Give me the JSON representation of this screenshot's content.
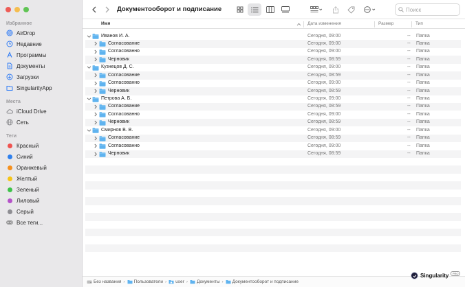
{
  "window": {
    "title": "Документооборот и подписание"
  },
  "sidebar": {
    "favorites_title": "Избранное",
    "favorites": [
      {
        "label": "AirDrop",
        "icon": "airdrop-icon"
      },
      {
        "label": "Недавние",
        "icon": "clock-icon"
      },
      {
        "label": "Программы",
        "icon": "applications-icon"
      },
      {
        "label": "Документы",
        "icon": "document-icon"
      },
      {
        "label": "Загрузки",
        "icon": "download-icon"
      },
      {
        "label": "SingularityApp",
        "icon": "folder-icon"
      }
    ],
    "places_title": "Места",
    "places": [
      {
        "label": "iCloud Drive",
        "icon": "cloud-icon"
      },
      {
        "label": "Сеть",
        "icon": "network-icon"
      }
    ],
    "tags_title": "Теги",
    "tags": [
      {
        "label": "Красный",
        "color": "#ef5350"
      },
      {
        "label": "Синий",
        "color": "#2f80ed"
      },
      {
        "label": "Оранжевый",
        "color": "#f5901e"
      },
      {
        "label": "Желтый",
        "color": "#f5c518"
      },
      {
        "label": "Зеленый",
        "color": "#3ec24a"
      },
      {
        "label": "Лиловый",
        "color": "#b553c9"
      },
      {
        "label": "Серый",
        "color": "#8e8e93"
      }
    ],
    "all_tags": "Все теги..."
  },
  "search": {
    "placeholder": "Поиск"
  },
  "columns": {
    "name": "Имя",
    "date": "Дата изменения",
    "size": "Размер",
    "kind": "Тип"
  },
  "rows": [
    {
      "name": "Иванов И. А.",
      "date": "Сегодня, 09:00",
      "size": "--",
      "kind": "Папка",
      "level": 0
    },
    {
      "name": "Согласование",
      "date": "Сегодня, 09:00",
      "size": "--",
      "kind": "Папка",
      "level": 1
    },
    {
      "name": "Согласованно",
      "date": "Сегодня, 09:00",
      "size": "--",
      "kind": "Папка",
      "level": 1
    },
    {
      "name": "Черновик",
      "date": "Сегодня, 08:59",
      "size": "--",
      "kind": "Папка",
      "level": 1
    },
    {
      "name": "Кузнецов Д. С.",
      "date": "Сегодня, 09:00",
      "size": "--",
      "kind": "Папка",
      "level": 0
    },
    {
      "name": "Согласование",
      "date": "Сегодня, 08:59",
      "size": "--",
      "kind": "Папка",
      "level": 1
    },
    {
      "name": "Согласованно",
      "date": "Сегодня, 09:00",
      "size": "--",
      "kind": "Папка",
      "level": 1
    },
    {
      "name": "Черновик",
      "date": "Сегодня, 08:59",
      "size": "--",
      "kind": "Папка",
      "level": 1
    },
    {
      "name": "Петрова А. Б.",
      "date": "Сегодня, 09:00",
      "size": "--",
      "kind": "Папка",
      "level": 0
    },
    {
      "name": "Согласование",
      "date": "Сегодня, 08:59",
      "size": "--",
      "kind": "Папка",
      "level": 1
    },
    {
      "name": "Согласованно",
      "date": "Сегодня, 09:00",
      "size": "--",
      "kind": "Папка",
      "level": 1
    },
    {
      "name": "Черновик",
      "date": "Сегодня, 08:59",
      "size": "--",
      "kind": "Папка",
      "level": 1
    },
    {
      "name": "Смирнов В. В.",
      "date": "Сегодня, 09:00",
      "size": "--",
      "kind": "Папка",
      "level": 0
    },
    {
      "name": "Согласование",
      "date": "Сегодня, 08:59",
      "size": "--",
      "kind": "Папка",
      "level": 1
    },
    {
      "name": "Согласованно",
      "date": "Сегодня, 09:00",
      "size": "--",
      "kind": "Папка",
      "level": 1
    },
    {
      "name": "Черновик",
      "date": "Сегодня, 08:59",
      "size": "--",
      "kind": "Папка",
      "level": 1
    }
  ],
  "pathbar": [
    {
      "label": "Без названия",
      "icon": "disk-icon"
    },
    {
      "label": "Пользователи",
      "icon": "folder-icon"
    },
    {
      "label": "user",
      "icon": "home-icon"
    },
    {
      "label": "Документы",
      "icon": "folder-icon"
    },
    {
      "label": "Документооборот и подписание",
      "icon": "folder-icon"
    }
  ],
  "watermark": {
    "text": "Singularity",
    "badge": "PRO"
  },
  "colors": {
    "accent": "#2f7bf5",
    "folder": "#5fb3ef",
    "sidebar_bg": "#e9e8ea"
  }
}
